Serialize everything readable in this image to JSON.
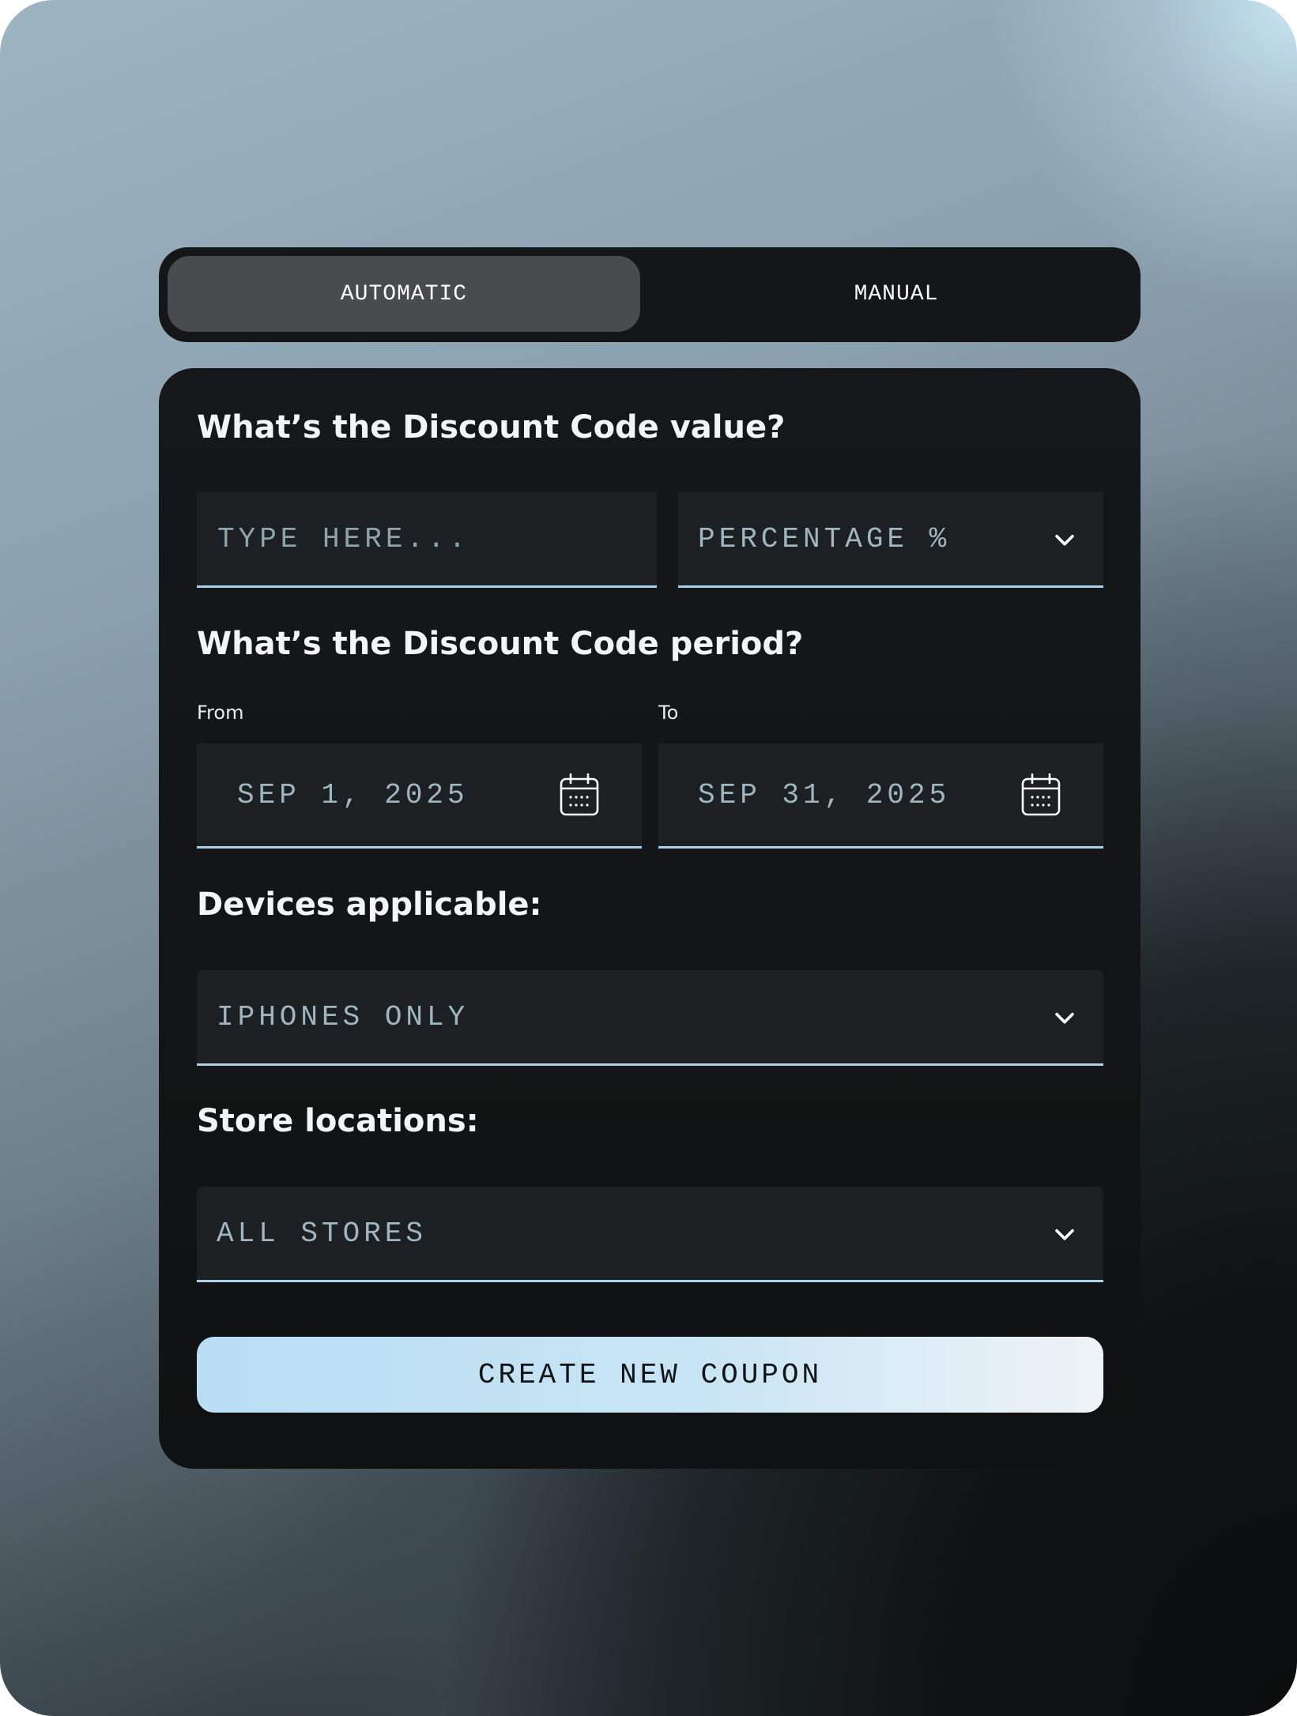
{
  "mode_toggle": {
    "options": [
      {
        "label": "AUTOMATIC",
        "selected": true
      },
      {
        "label": "MANUAL",
        "selected": false
      }
    ]
  },
  "value_section": {
    "question": "What’s the Discount Code value?",
    "value_input": {
      "placeholder": "TYPE HERE...",
      "value": ""
    },
    "type_select": {
      "selected": "PERCENTAGE %"
    }
  },
  "period_section": {
    "question": "What’s the Discount Code period?",
    "from": {
      "label": "From",
      "value": "SEP 1, 2025"
    },
    "to": {
      "label": "To",
      "value": "SEP 31, 2025"
    }
  },
  "devices_section": {
    "question": "Devices applicable:",
    "select": {
      "selected": "IPHONES ONLY"
    }
  },
  "stores_section": {
    "question": "Store locations:",
    "select": {
      "selected": "ALL STORES"
    }
  },
  "submit_button": {
    "label": "CREATE NEW COUPON"
  },
  "colors": {
    "accent_underline": "#a9d2e8",
    "card_background": "#141618",
    "toggle_selected": "#4a4b4d",
    "cta_gradient_start": "#b9def3",
    "cta_gradient_end": "#eef3f6"
  },
  "icons": {
    "dropdown": "chevron-down-icon",
    "date": "calendar-icon"
  }
}
